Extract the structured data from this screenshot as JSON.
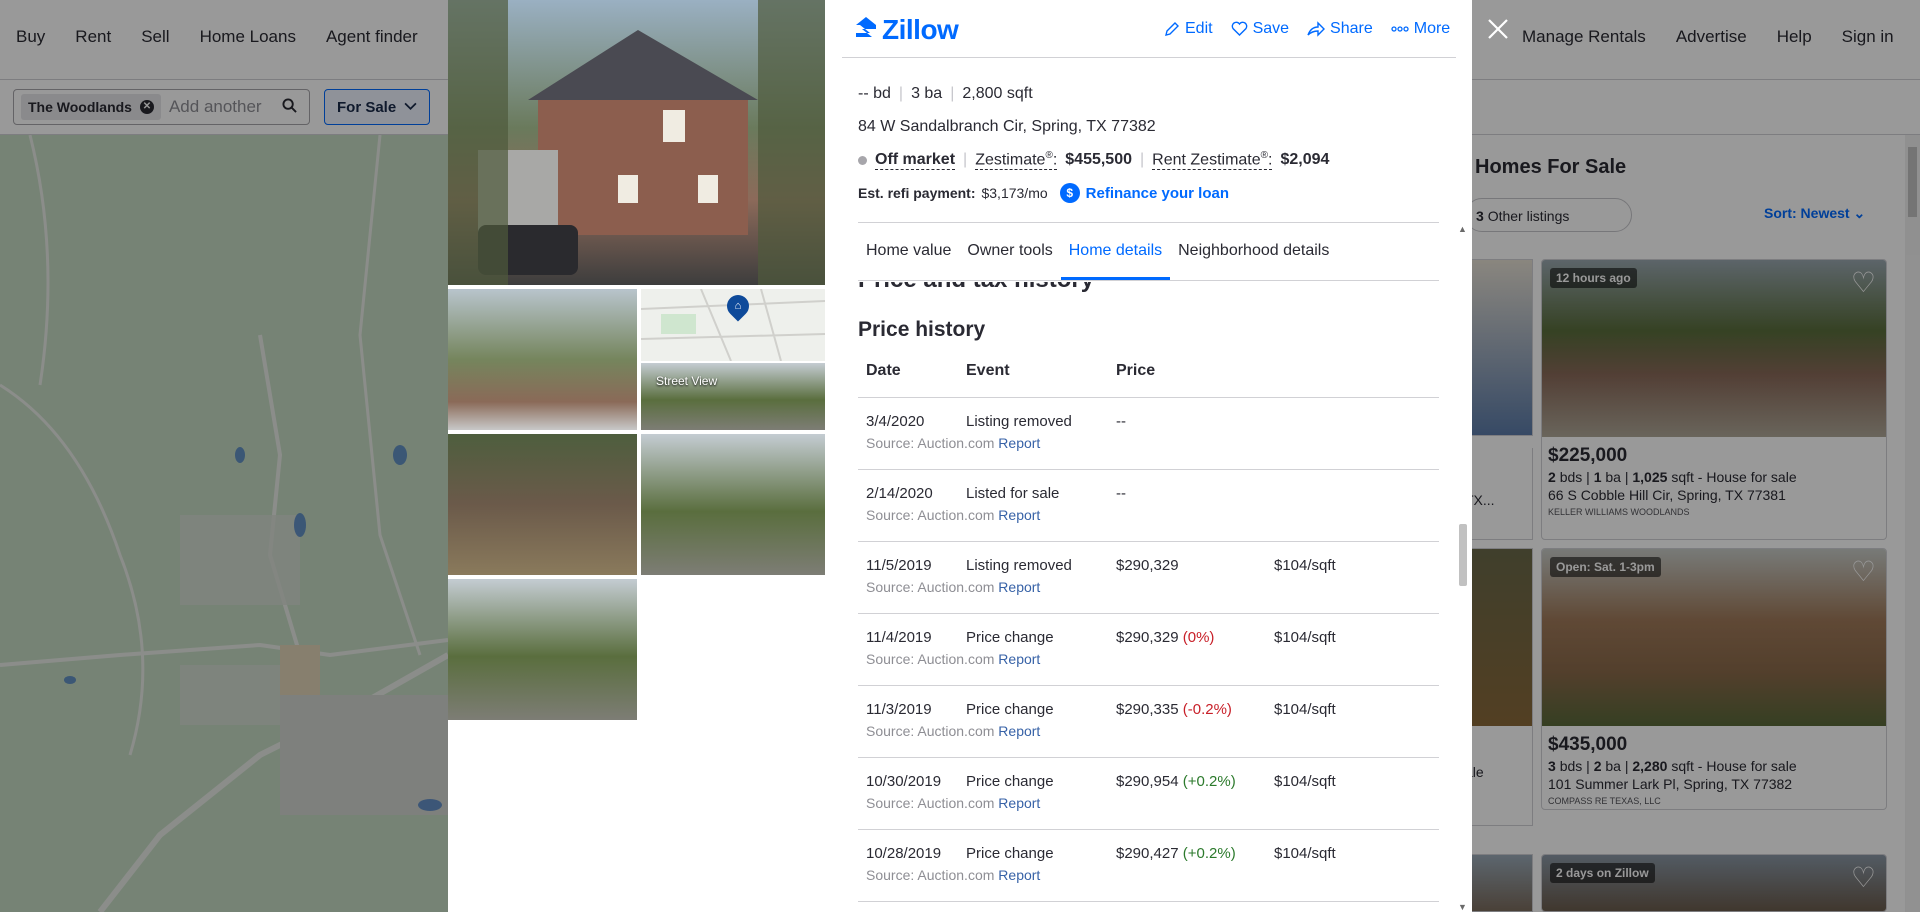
{
  "bg_nav": {
    "left": [
      "Buy",
      "Rent",
      "Sell",
      "Home Loans",
      "Agent finder"
    ],
    "right": [
      "Manage Rentals",
      "Advertise",
      "Help",
      "Sign in"
    ]
  },
  "search": {
    "chip": "The Woodlands",
    "placeholder": "Add another",
    "for_sale": "For Sale"
  },
  "listings": {
    "title": "Homes For Sale",
    "other_count": "3",
    "other_label": "Other listings",
    "sort": "Sort: Newest",
    "cards": [
      {
        "badge": "12 hours ago",
        "price": "$225,000",
        "beds": "2",
        "beds_unit": "bds",
        "baths": "1",
        "baths_unit": "ba",
        "sqft": "1,025",
        "sqft_unit": "sqft",
        "type": "- House for sale",
        "address": "66 S Cobble Hill Cir, Spring, TX 77381",
        "broker": "KELLER WILLIAMS WOODLANDS"
      },
      {
        "badge": "Open: Sat. 1-3pm",
        "price": "$435,000",
        "beds": "3",
        "beds_unit": "bds",
        "baths": "2",
        "baths_unit": "ba",
        "sqft": "2,280",
        "sqft_unit": "sqft",
        "type": "- House for sale",
        "address": "101 Summer Lark Pl, Spring, TX 77382",
        "broker": "COMPASS RE TEXAS, LLC"
      },
      {
        "badge": "2 days on Zillow"
      }
    ],
    "left_partials": [
      "TX...",
      "ale"
    ]
  },
  "modal": {
    "logo": "Zillow",
    "actions": [
      "Edit",
      "Save",
      "Share",
      "More"
    ],
    "street_view": "Street View",
    "facts": {
      "beds": "-- bd",
      "baths": "3 ba",
      "sqft": "2,800 sqft"
    },
    "address": "84 W Sandalbranch Cir, Spring, TX 77382",
    "status": "Off market",
    "zestimate_label": "Zestimate",
    "zestimate_value": "$455,500",
    "rent_label": "Rent Zestimate",
    "rent_value": "$2,094",
    "registered": "®",
    "refi_label": "Est. refi payment:",
    "refi_value": "$3,173/mo",
    "refi_icon": "$",
    "refi_link": "Refinance your loan",
    "tabs": [
      "Home value",
      "Owner tools",
      "Home details",
      "Neighborhood details"
    ],
    "section_title": "Price and tax history",
    "history_title": "Price history",
    "columns": [
      "Date",
      "Event",
      "Price"
    ],
    "source_label": "Source: Auction.com",
    "report_label": "Report",
    "rows": [
      {
        "date": "3/4/2020",
        "event": "Listing removed",
        "price": "--",
        "change": "",
        "change_dir": "",
        "per_sqft": ""
      },
      {
        "date": "2/14/2020",
        "event": "Listed for sale",
        "price": "--",
        "change": "",
        "change_dir": "",
        "per_sqft": ""
      },
      {
        "date": "11/5/2019",
        "event": "Listing removed",
        "price": "$290,329",
        "change": "",
        "change_dir": "",
        "per_sqft": "$104/sqft"
      },
      {
        "date": "11/4/2019",
        "event": "Price change",
        "price": "$290,329",
        "change": "(0%)",
        "change_dir": "neg",
        "per_sqft": "$104/sqft"
      },
      {
        "date": "11/3/2019",
        "event": "Price change",
        "price": "$290,335",
        "change": "(-0.2%)",
        "change_dir": "neg",
        "per_sqft": "$104/sqft"
      },
      {
        "date": "10/30/2019",
        "event": "Price change",
        "price": "$290,954",
        "change": "(+0.2%)",
        "change_dir": "pos",
        "per_sqft": "$104/sqft"
      },
      {
        "date": "10/28/2019",
        "event": "Price change",
        "price": "$290,427",
        "change": "(+0.2%)",
        "change_dir": "pos",
        "per_sqft": "$104/sqft"
      }
    ]
  },
  "colors": {
    "accent": "#006aff",
    "negative": "#c81f28",
    "positive": "#2c7a2c"
  },
  "icons": [
    "search-icon",
    "chevron-down-icon",
    "heart-icon",
    "close-icon",
    "edit-icon",
    "save-heart-icon",
    "share-icon",
    "more-icon",
    "zillow-logo-icon",
    "dollar-icon",
    "map-pin-icon"
  ]
}
